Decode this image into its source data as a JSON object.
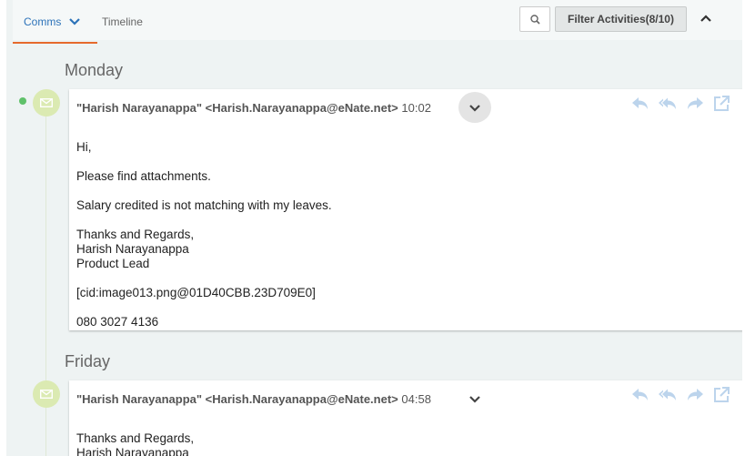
{
  "tabs": [
    {
      "label": "Comms",
      "active": true
    },
    {
      "label": "Timeline",
      "active": false
    }
  ],
  "toolbar": {
    "search_icon": "search-icon",
    "filter_label": "Filter Activities(8/10)",
    "collapse_icon": "chevron-up-icon"
  },
  "colors": {
    "accent": "#2d73b9",
    "tab_underline": "#e66a2c",
    "status_dot": "#5fc16a",
    "avatar_bg": "#dbeab2",
    "action_icons": "#bcd4ec"
  },
  "days": [
    {
      "label": "Monday",
      "email": {
        "sender": "\"Harish Narayanappa\" <Harish.Narayanappa@eNate.net>",
        "time": "10:02",
        "body": {
          "greeting": "Hi,",
          "line1": "Please find attachments.",
          "line2": "Salary credited is not matching with my leaves.",
          "sign1": "Thanks and Regards,",
          "sign2": "Harish Narayanappa",
          "sign3": "Product Lead",
          "image_ref": "[cid:image013.png@01D40CBB.23D709E0]",
          "phone": "080 3027 4136"
        }
      }
    },
    {
      "label": "Friday",
      "email": {
        "sender": "\"Harish Narayanappa\" <Harish.Narayanappa@eNate.net>",
        "time": "04:58",
        "body": {
          "sign1": "Thanks and Regards,",
          "sign2": "Harish Narayanappa"
        }
      }
    }
  ],
  "icons": {
    "avatar": "envelope-icon",
    "reply": "reply-icon",
    "reply_all": "reply-all-icon",
    "forward": "forward-icon",
    "open": "external-link-icon",
    "expand": "chevron-down-icon"
  }
}
